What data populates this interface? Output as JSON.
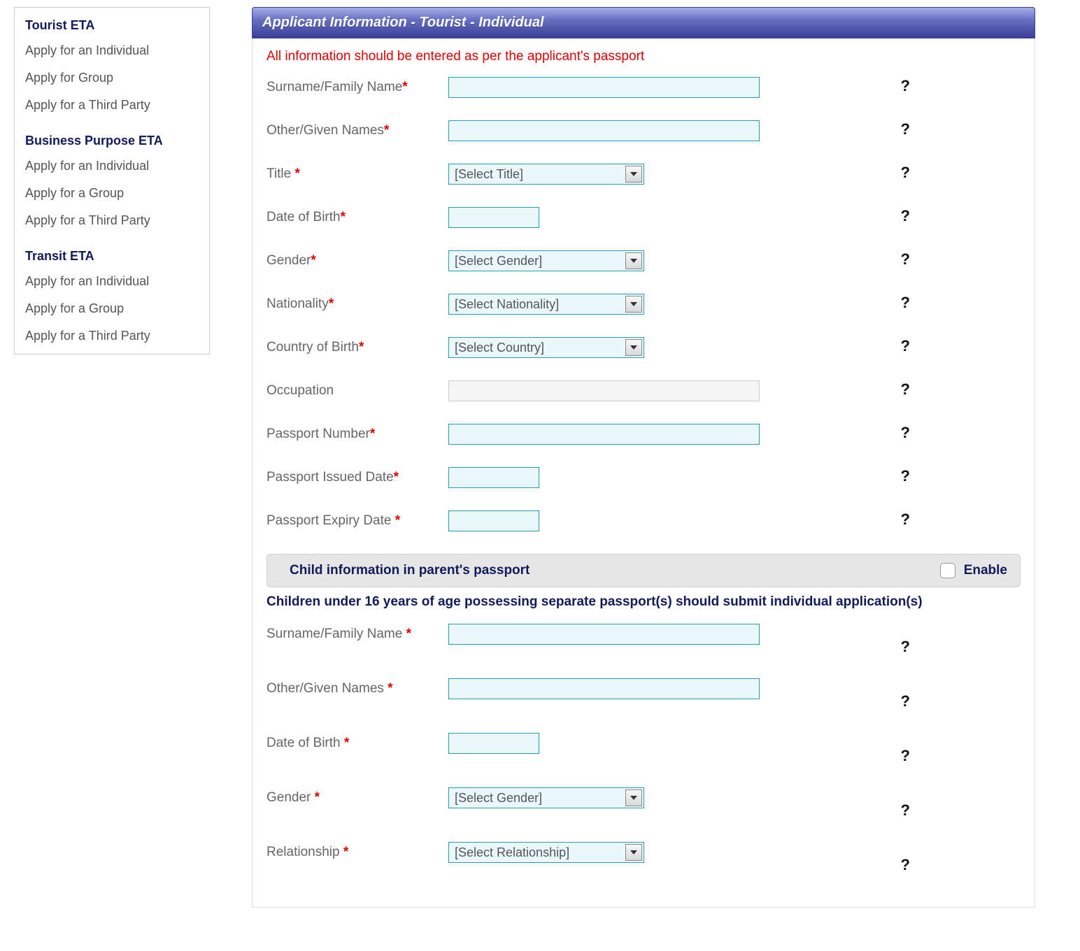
{
  "sidebar": {
    "sections": [
      {
        "heading": "Tourist ETA",
        "items": [
          "Apply for an Individual",
          "Apply for Group",
          "Apply for a Third Party"
        ]
      },
      {
        "heading": "Business Purpose ETA",
        "items": [
          "Apply for an Individual",
          "Apply for a Group",
          "Apply for a Third Party"
        ]
      },
      {
        "heading": "Transit ETA",
        "items": [
          "Apply for an Individual",
          "Apply for a Group",
          "Apply for a Third Party"
        ]
      }
    ]
  },
  "panel": {
    "title": "Applicant Information - Tourist - Individual",
    "notice": "All information should be entered as per the applicant's passport",
    "fields": [
      {
        "label": "Surname/Family Name",
        "required": true,
        "type": "text"
      },
      {
        "label": "Other/Given Names",
        "required": true,
        "type": "text"
      },
      {
        "label": "Title ",
        "required": true,
        "type": "select",
        "placeholder": "[Select Title]"
      },
      {
        "label": "Date of Birth",
        "required": true,
        "type": "short"
      },
      {
        "label": "Gender",
        "required": true,
        "type": "select",
        "placeholder": "[Select Gender]"
      },
      {
        "label": "Nationality",
        "required": true,
        "type": "select",
        "placeholder": "[Select Nationality]"
      },
      {
        "label": "Country of Birth",
        "required": true,
        "type": "select",
        "placeholder": "[Select Country]"
      },
      {
        "label": "Occupation",
        "required": false,
        "type": "disabled"
      },
      {
        "label": "Passport Number",
        "required": true,
        "type": "text"
      },
      {
        "label": "Passport Issued Date",
        "required": true,
        "type": "short"
      },
      {
        "label": "Passport Expiry Date ",
        "required": true,
        "type": "short"
      }
    ]
  },
  "child_section": {
    "title": "Child information in parent's passport",
    "enable_label": "Enable",
    "notice": "Children under 16 years of age possessing separate passport(s) should submit individual application(s)",
    "fields": [
      {
        "label": "Surname/Family Name ",
        "required": true,
        "type": "text"
      },
      {
        "label": "Other/Given Names ",
        "required": true,
        "type": "text"
      },
      {
        "label": "Date of Birth ",
        "required": true,
        "type": "short"
      },
      {
        "label": "Gender ",
        "required": true,
        "type": "select",
        "placeholder": "[Select Gender]"
      },
      {
        "label": "Relationship ",
        "required": true,
        "type": "select",
        "placeholder": "[Select Relationship]"
      }
    ]
  },
  "help_glyph": "?"
}
